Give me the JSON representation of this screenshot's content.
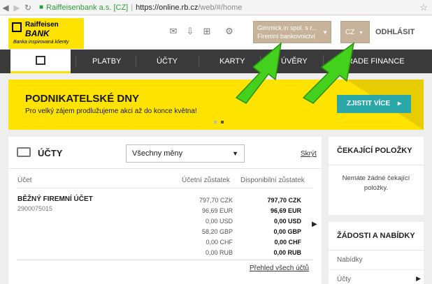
{
  "browser": {
    "site_label": "Raiffeisenbank a.s. [CZ]",
    "url_host": "https://online.rb.cz",
    "url_path": "/web/#/home"
  },
  "logo": {
    "line1": "Raiffeisen",
    "line2": "BANK",
    "tagline": "Banka inspirovaná klienty"
  },
  "header": {
    "account_name": "Gimmick.in spol. s r...",
    "account_type": "Firemní bankovnictví",
    "language": "CZ",
    "logout": "ODHLÁSIT"
  },
  "nav": {
    "items": [
      "PLATBY",
      "ÚČTY",
      "KARTY",
      "ÚVĚRY",
      "TRADE FINANCE"
    ]
  },
  "banner": {
    "title": "PODNIKATELSKÉ DNY",
    "subtitle": "Pro velký zájem prodlužujeme akci až do konce května!",
    "cta": "ZJISTIT VÍCE"
  },
  "accounts": {
    "title": "ÚČTY",
    "currency_filter": "Všechny měny",
    "hide": "Skrýt",
    "col_account": "Účet",
    "col_ledger": "Účetní zůstatek",
    "col_available": "Disponibilní zůstatek",
    "account_name": "BĚŽNÝ FIREMNÍ ÚČET",
    "account_number": "2900075015",
    "ledger": [
      "797,70 CZK",
      "96,69 EUR",
      "0,00 USD",
      "58,20 GBP",
      "0,00 CHF",
      "0,00 RUB"
    ],
    "available": [
      "797,70 CZK",
      "96,69 EUR",
      "0,00 USD",
      "0,00 GBP",
      "0,00 CHF",
      "0,00 RUB"
    ],
    "overview_link": "Přehled všech účtů"
  },
  "pending": {
    "title": "ČEKAJÍCÍ POLOŽKY",
    "message": "Nemáte žádné čekající položky."
  },
  "requests": {
    "title": "ŽÁDOSTI A NABÍDKY",
    "links": [
      "Nabídky",
      "Účty"
    ]
  },
  "colors": {
    "brand_yellow": "#fee300",
    "nav_dark": "#3a3a3a",
    "accent_teal": "#2aa8a8",
    "highlight_tan": "#c6b39a",
    "arrow_green": "#44d11e"
  }
}
